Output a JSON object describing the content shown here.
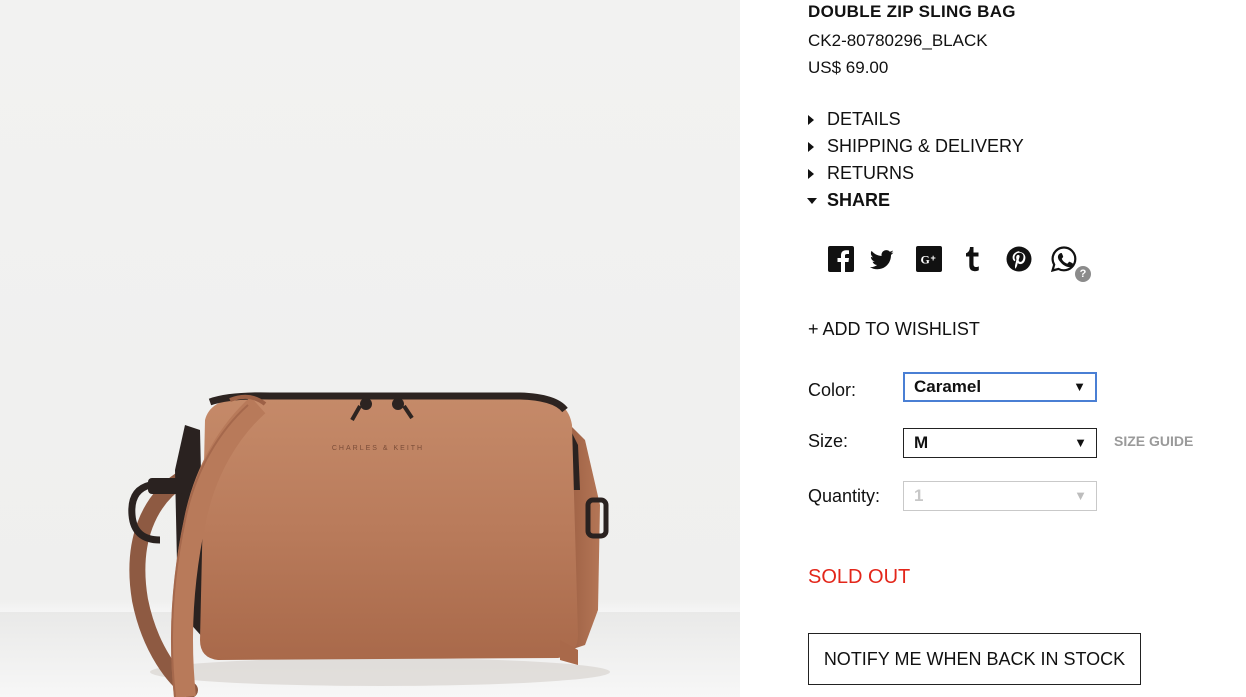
{
  "product": {
    "name": "DOUBLE ZIP SLING BAG",
    "sku": "CK2-80780296_BLACK",
    "price": "US$ 69.00",
    "brand_stamp": "CHARLES & KEITH",
    "bag_color": "#b97b5b"
  },
  "accordion": [
    {
      "label": "DETAILS",
      "expanded": false
    },
    {
      "label": "SHIPPING & DELIVERY",
      "expanded": false
    },
    {
      "label": "RETURNS",
      "expanded": false
    },
    {
      "label": "SHARE",
      "expanded": true
    }
  ],
  "share_icons": [
    "facebook-icon",
    "twitter-icon",
    "google-plus-icon",
    "tumblr-icon",
    "pinterest-icon",
    "whatsapp-icon"
  ],
  "share_help": "?",
  "wishlist_label": "+ ADD TO WISHLIST",
  "options": {
    "color_label": "Color:",
    "color_value": "Caramel",
    "size_label": "Size:",
    "size_value": "M",
    "size_guide": "SIZE GUIDE",
    "quantity_label": "Quantity:",
    "quantity_value": "1",
    "arrow": "▼"
  },
  "status": {
    "text": "SOLD OUT",
    "color": "#e3261a"
  },
  "notify_label": "NOTIFY ME WHEN BACK IN STOCK"
}
